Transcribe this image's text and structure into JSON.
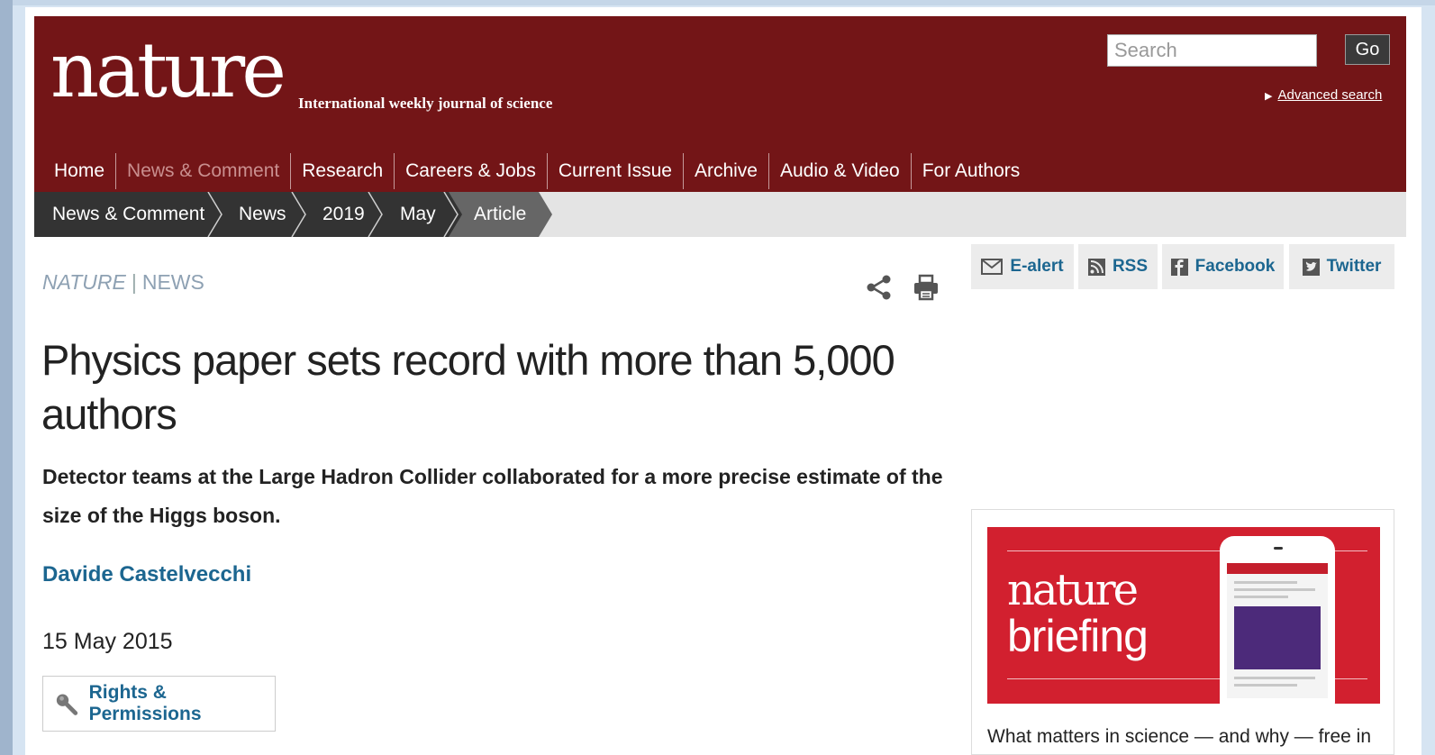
{
  "header": {
    "logo": "nature",
    "tagline": "International weekly journal of science",
    "search_placeholder": "Search",
    "go_label": "Go",
    "advanced_search": "Advanced search"
  },
  "nav": [
    {
      "label": "Home",
      "active": true
    },
    {
      "label": "News & Comment",
      "active": false
    },
    {
      "label": "Research",
      "active": true
    },
    {
      "label": "Careers & Jobs",
      "active": true
    },
    {
      "label": "Current Issue",
      "active": true
    },
    {
      "label": "Archive",
      "active": true
    },
    {
      "label": "Audio & Video",
      "active": true
    },
    {
      "label": "For Authors",
      "active": true
    }
  ],
  "breadcrumb": [
    "News & Comment",
    "News",
    "2019",
    "May",
    "Article"
  ],
  "article": {
    "journal": "NATURE",
    "separator": "|",
    "section": "NEWS",
    "headline": "Physics paper sets record with more than 5,000 authors",
    "standfirst": "Detector teams at the Large Hadron Collider collaborated for a more precise estimate of the size of the Higgs boson.",
    "author": "Davide Castelvecchi",
    "date": "15 May 2015",
    "rights_label": "Rights & Permissions"
  },
  "social": {
    "ealert": "E-alert",
    "rss": "RSS",
    "facebook": "Facebook",
    "twitter": "Twitter"
  },
  "ad": {
    "logo_top": "nature",
    "logo_bottom": "briefing",
    "caption": "What matters in science — and why — free in"
  },
  "colors": {
    "header_bg": "#731517",
    "link": "#1c6690",
    "crumb_dark": "#333333",
    "crumb_active": "#666666",
    "ad_red": "#d2202f"
  },
  "icons": [
    "share-icon",
    "print-icon",
    "magnifier-icon",
    "mail-icon",
    "rss-icon",
    "facebook-icon",
    "twitter-icon"
  ]
}
